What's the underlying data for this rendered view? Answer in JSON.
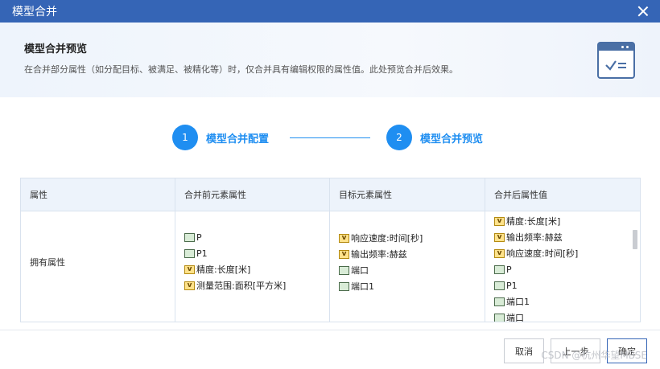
{
  "window": {
    "title": "模型合并"
  },
  "banner": {
    "title": "模型合并预览",
    "description": "在合并部分属性（如分配目标、被满足、被精化等）时，仅合并具有编辑权限的属性值。此处预览合并后效果。"
  },
  "steps": [
    {
      "number": "1",
      "label": "模型合并配置"
    },
    {
      "number": "2",
      "label": "模型合并预览"
    }
  ],
  "table": {
    "headers": [
      "属性",
      "合并前元素属性",
      "目标元素属性",
      "合并后属性值"
    ],
    "row_label": "拥有属性",
    "before": [
      {
        "icon": "port-icon",
        "text": "P"
      },
      {
        "icon": "port-icon",
        "text": "P1"
      },
      {
        "icon": "value-property-icon",
        "text": "精度:长度[米]"
      },
      {
        "icon": "value-property-icon",
        "text": "测量范围:面积[平方米]"
      }
    ],
    "target": [
      {
        "icon": "value-property-icon",
        "text": "响应速度:时间[秒]"
      },
      {
        "icon": "value-property-icon",
        "text": "输出频率:赫兹"
      },
      {
        "icon": "port-icon",
        "text": "端口"
      },
      {
        "icon": "port-icon",
        "text": "端口1"
      }
    ],
    "merged": [
      {
        "icon": "value-property-icon",
        "text": "精度:长度[米]"
      },
      {
        "icon": "value-property-icon",
        "text": "输出频率:赫兹"
      },
      {
        "icon": "value-property-icon",
        "text": "响应速度:时间[秒]"
      },
      {
        "icon": "port-icon",
        "text": "P"
      },
      {
        "icon": "port-icon",
        "text": "P1"
      },
      {
        "icon": "port-icon",
        "text": "端口1"
      },
      {
        "icon": "port-icon",
        "text": "端口"
      }
    ]
  },
  "footer": {
    "cancel": "取消",
    "prev": "上一步",
    "ok": "确定",
    "watermark": "CSDN @杭州华望MBSE"
  },
  "colors": {
    "titlebar": "#3565b6",
    "accent": "#1f8ef1"
  }
}
